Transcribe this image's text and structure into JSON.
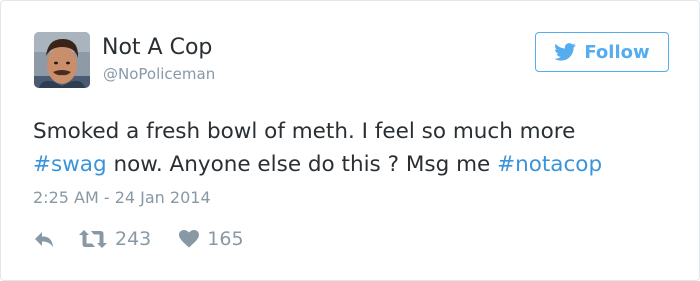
{
  "user": {
    "display_name": "Not A Cop",
    "handle": "@NoPoliceman"
  },
  "follow_button": {
    "label": "Follow",
    "icon": "twitter-bird-icon"
  },
  "tweet": {
    "text_line1": "Smoked a fresh bowl of meth. I feel so much more",
    "hashtag1": "#swag",
    "text_middle": " now. Anyone else do this ? Msg me ",
    "hashtag2": "#notacop",
    "timestamp": "2:25 AM - 24 Jan 2014"
  },
  "actions": {
    "reply_icon": "reply-icon",
    "retweet_icon": "retweet-icon",
    "retweet_count": "243",
    "like_icon": "heart-icon",
    "like_count": "165"
  },
  "colors": {
    "accent": "#55acee",
    "hashtag": "#3b94d9",
    "text": "#292f33",
    "muted": "#8899a6",
    "border": "#e1e8ed"
  }
}
